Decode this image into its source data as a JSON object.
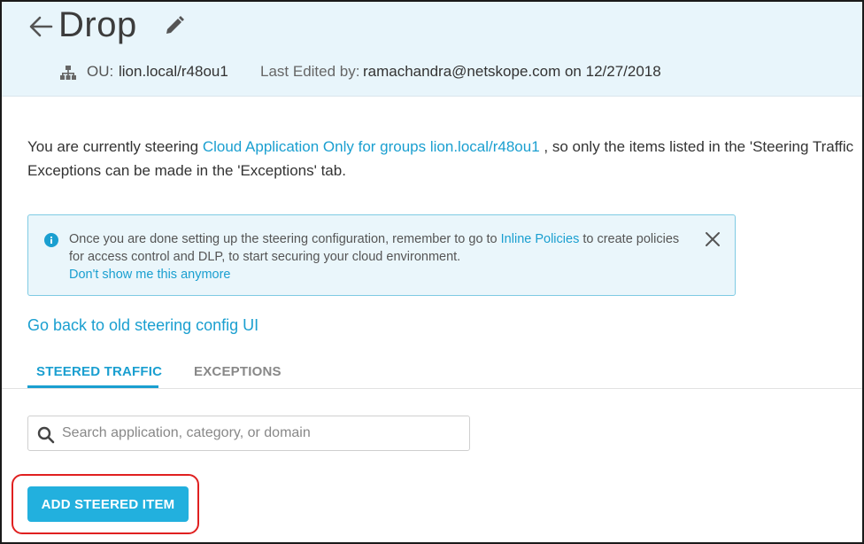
{
  "header": {
    "title": "Drop",
    "ou_label": "OU:",
    "ou_value": "lion.local/r48ou1",
    "edited_label": "Last Edited by:",
    "edited_value": "ramachandra@netskope.com on 12/27/2018",
    "icons": [
      "back-arrow-icon",
      "pencil-icon",
      "org-tree-icon"
    ]
  },
  "intro": {
    "line1_prefix": "You are currently steering ",
    "line1_link": "Cloud Application Only for groups lion.local/r48ou1",
    "line1_suffix": " , so only the items listed in the 'Steering Traffic",
    "line2": "Exceptions can be made in the 'Exceptions' tab."
  },
  "info_box": {
    "line1_prefix": "Once you are done setting up the steering configuration, remember to go to ",
    "line1_link": "Inline Policies",
    "line1_suffix": " to create policies",
    "line2": "for access control and DLP, to start securing your cloud environment.",
    "dismiss_link": "Don't show me this anymore",
    "icons": [
      "info-icon",
      "close-icon"
    ]
  },
  "old_ui_link": "Go back to old steering config UI",
  "tabs": [
    {
      "label": "STEERED TRAFFIC",
      "active": true
    },
    {
      "label": "EXCEPTIONS",
      "active": false
    }
  ],
  "search": {
    "value": "",
    "placeholder": "Search application, category, or domain"
  },
  "add_button_label": "ADD STEERED ITEM",
  "colors": {
    "accent": "#22b0de",
    "link": "#1a9fd0",
    "header_bg": "#e8f5fb",
    "annotation": "#e02020"
  }
}
